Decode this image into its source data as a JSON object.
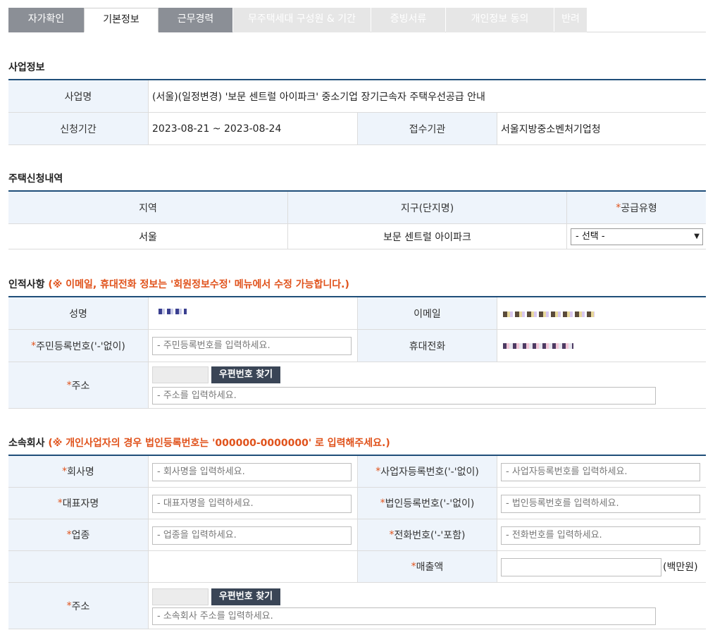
{
  "tabs": [
    {
      "label": "자가확인",
      "state": "done"
    },
    {
      "label": "기본정보",
      "state": "active"
    },
    {
      "label": "근무경력",
      "state": "done"
    },
    {
      "label": "무주택세대 구성원 & 기간",
      "state": "disabled"
    },
    {
      "label": "증빙서류",
      "state": "disabled"
    },
    {
      "label": "개인정보 동의",
      "state": "disabled"
    },
    {
      "label": "반려",
      "state": "disabled"
    }
  ],
  "business": {
    "title": "사업정보",
    "name_label": "사업명",
    "name_value": "(서울)(일정변경) '보문 센트럴 아이파크' 중소기업 장기근속자 주택우선공급 안내",
    "period_label": "신청기간",
    "period_value": "2023-08-21 ~ 2023-08-24",
    "agency_label": "접수기관",
    "agency_value": "서울지방중소벤처기업청"
  },
  "housing": {
    "title": "주택신청내역",
    "col_region": "지역",
    "col_district": "지구(단지명)",
    "col_supply": "공급유형",
    "region_value": "서울",
    "district_value": "보문 센트럴 아이파크",
    "supply_selected": "- 선택 -"
  },
  "personal": {
    "title": "인적사항",
    "note": "(※ 이메일, 휴대전화 정보는 '회원정보수정' 메뉴에서 수정 가능합니다.)",
    "name_label": "성명",
    "email_label": "이메일",
    "rrn_label": "주민등록번호('-'없이)",
    "rrn_placeholder": "- 주민등록번호를 입력하세요.",
    "phone_label": "휴대전화",
    "address_label": "주소",
    "zip_button": "우편번호 찾기",
    "address_placeholder": "- 주소를 입력하세요."
  },
  "company": {
    "title": "소속회사",
    "note": "(※ 개인사업자의 경우 법인등록번호는 '000000-0000000' 로 입력해주세요.)",
    "company_name_label": "회사명",
    "company_name_placeholder": "- 회사명을 입력하세요.",
    "biz_reg_label": "사업자등록번호('-'없이)",
    "biz_reg_placeholder": "- 사업자등록번호를 입력하세요.",
    "ceo_label": "대표자명",
    "ceo_placeholder": "- 대표자명을 입력하세요.",
    "corp_reg_label": "법인등록번호('-'없이)",
    "corp_reg_placeholder": "- 법인등록번호를 입력하세요.",
    "industry_label": "업종",
    "industry_placeholder": "- 업종을 입력하세요.",
    "tel_label": "전화번호('-'포함)",
    "tel_placeholder": "- 전화번호를 입력하세요.",
    "sales_label": "매출액",
    "sales_unit": "(백만원)",
    "address_label": "주소",
    "zip_button": "우편번호 찾기",
    "address_placeholder": "- 소속회사 주소를 입력하세요."
  },
  "required_mark": "*",
  "colors": {
    "accent_line": "#1f4e79",
    "header_bg": "#eef4fb",
    "note": "#e0521b",
    "tab_done": "#8b8f96",
    "tab_disabled": "#e6e6e6",
    "button": "#3a4556"
  }
}
